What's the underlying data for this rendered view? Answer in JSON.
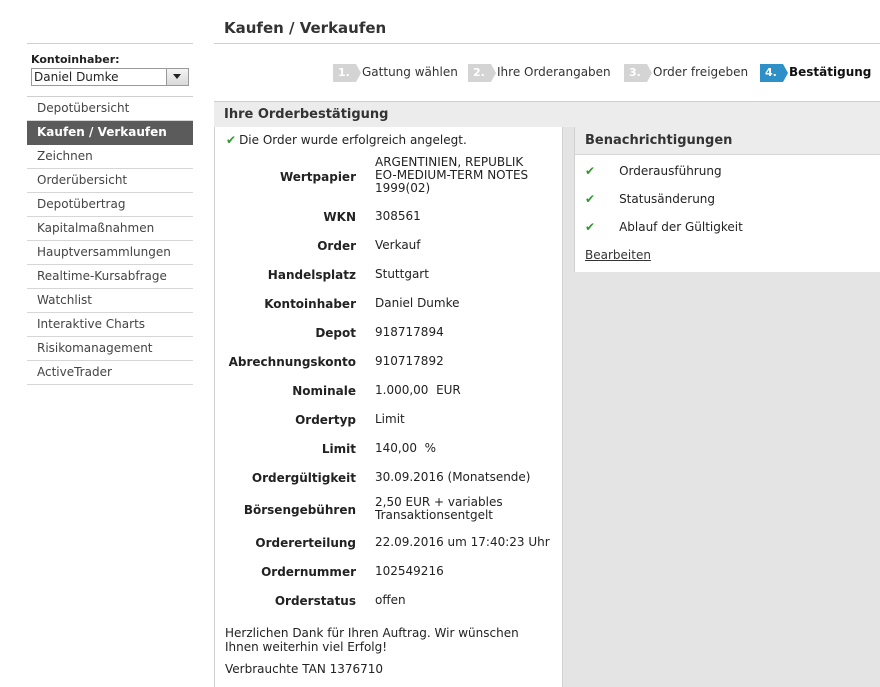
{
  "page_title": "Kaufen / Verkaufen",
  "sidebar": {
    "owner_label": "Kontoinhaber:",
    "owner_value": "Daniel Dumke",
    "items": [
      {
        "label": "Depotübersicht",
        "active": false
      },
      {
        "label": "Kaufen / Verkaufen",
        "active": true
      },
      {
        "label": "Zeichnen",
        "active": false
      },
      {
        "label": "Orderübersicht",
        "active": false
      },
      {
        "label": "Depotübertrag",
        "active": false
      },
      {
        "label": "Kapitalmaßnahmen",
        "active": false
      },
      {
        "label": "Hauptversammlungen",
        "active": false
      },
      {
        "label": "Realtime-Kursabfrage",
        "active": false
      },
      {
        "label": "Watchlist",
        "active": false
      },
      {
        "label": "Interaktive Charts",
        "active": false
      },
      {
        "label": "Risikomanagement",
        "active": false
      },
      {
        "label": "ActiveTrader",
        "active": false
      }
    ]
  },
  "steps": [
    {
      "num": "1.",
      "label": "Gattung wählen"
    },
    {
      "num": "2.",
      "label": "Ihre Orderangaben"
    },
    {
      "num": "3.",
      "label": "Order freigeben"
    },
    {
      "num": "4.",
      "label": "Bestätigung"
    }
  ],
  "confirmation": {
    "header": "Ihre Orderbestätigung",
    "success_message": "Die Order wurde erfolgreich angelegt.",
    "fields": [
      {
        "label": "Wertpapier",
        "value": "ARGENTINIEN, REPUBLIK\nEO-MEDIUM-TERM NOTES\n1999(02)"
      },
      {
        "label": "WKN",
        "value": "308561"
      },
      {
        "label": "Order",
        "value": "Verkauf"
      },
      {
        "label": "Handelsplatz",
        "value": "Stuttgart"
      },
      {
        "label": "Kontoinhaber",
        "value": "Daniel Dumke"
      },
      {
        "label": "Depot",
        "value": "918717894"
      },
      {
        "label": "Abrechnungskonto",
        "value": "910717892"
      },
      {
        "label": "Nominale",
        "value": "1.000,00  EUR"
      },
      {
        "label": "Ordertyp",
        "value": "Limit"
      },
      {
        "label": "Limit",
        "value": "140,00  %"
      },
      {
        "label": "Ordergültigkeit",
        "value": "30.09.2016 (Monatsende)"
      },
      {
        "label": "Börsengebühren",
        "value": "2,50 EUR + variables\nTransaktionsentgelt"
      },
      {
        "label": "Ordererteilung",
        "value": "22.09.2016 um 17:40:23 Uhr"
      },
      {
        "label": "Ordernummer",
        "value": "102549216"
      },
      {
        "label": "Orderstatus",
        "value": "offen"
      }
    ],
    "thanks": "Herzlichen Dank für Ihren Auftrag. Wir wünschen Ihnen weiterhin viel Erfolg!",
    "tan": "Verbrauchte TAN 1376710"
  },
  "notifications": {
    "header": "Benachrichtigungen",
    "items": [
      "Orderausführung",
      "Statusänderung",
      "Ablauf der Gültigkeit"
    ],
    "edit_label": "Bearbeiten"
  },
  "colors": {
    "active_step": "#2f8fc7",
    "active_nav": "#5b5b5b",
    "check": "#2e9a2e"
  }
}
